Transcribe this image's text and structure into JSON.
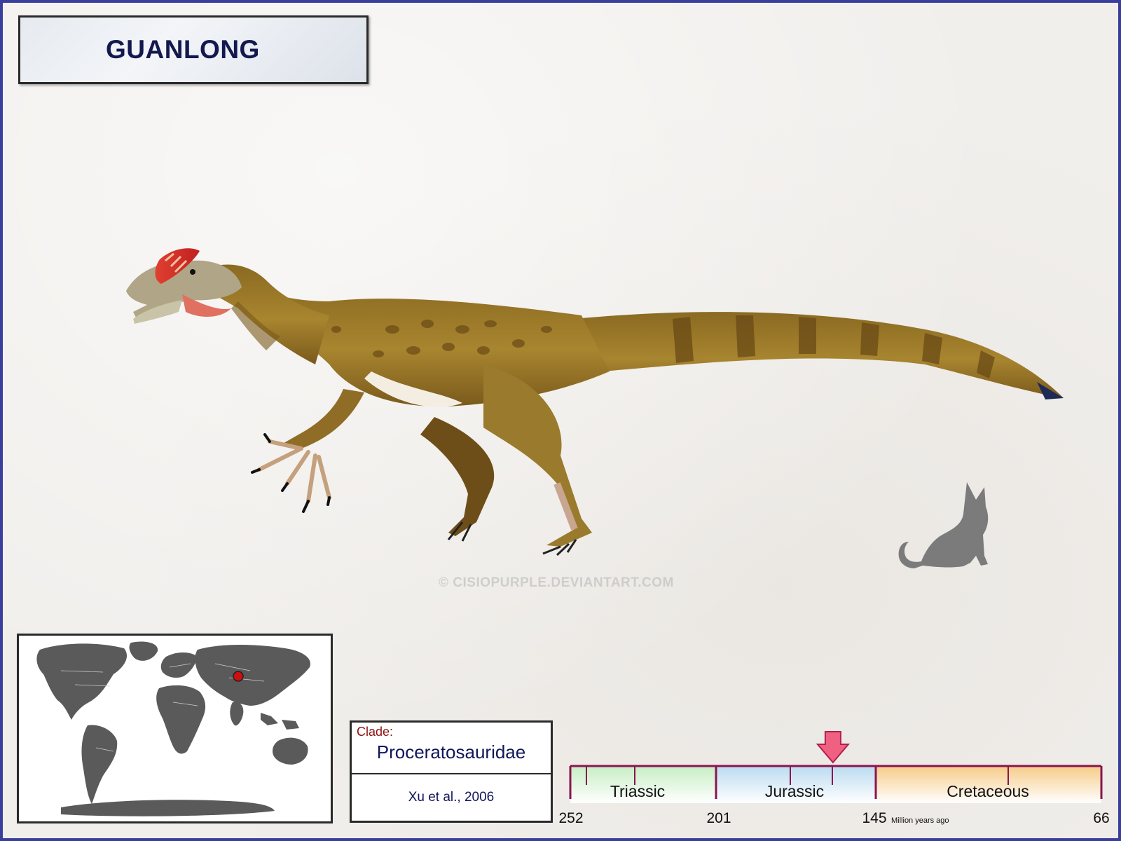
{
  "title": "GUANLONG",
  "watermark": "© CISIOPURPLE.DEVIANTART.COM",
  "clade": {
    "label": "Clade:",
    "name": "Proceratosauridae",
    "author": "Xu et al., 2006"
  },
  "timeline": {
    "periods": [
      "Triassic",
      "Jurassic",
      "Cretaceous"
    ],
    "ticks": [
      "252",
      "201",
      "145",
      "66"
    ],
    "unit": "Million years ago",
    "marker_ma": 160
  },
  "map": {
    "marker": "red dot in China (Asia)"
  },
  "icons": {
    "silhouette": "cat-silhouette-icon",
    "arrow": "down-arrow-icon"
  },
  "colors": {
    "border": "#3a3f9e",
    "title_text": "#13184f",
    "clade_label": "#8b1010",
    "triassic": "#c8eec4",
    "jurassic": "#bcdcf0",
    "cretaceous": "#f6cd8a",
    "arrow": "#f06080",
    "axis": "#8a1550"
  }
}
